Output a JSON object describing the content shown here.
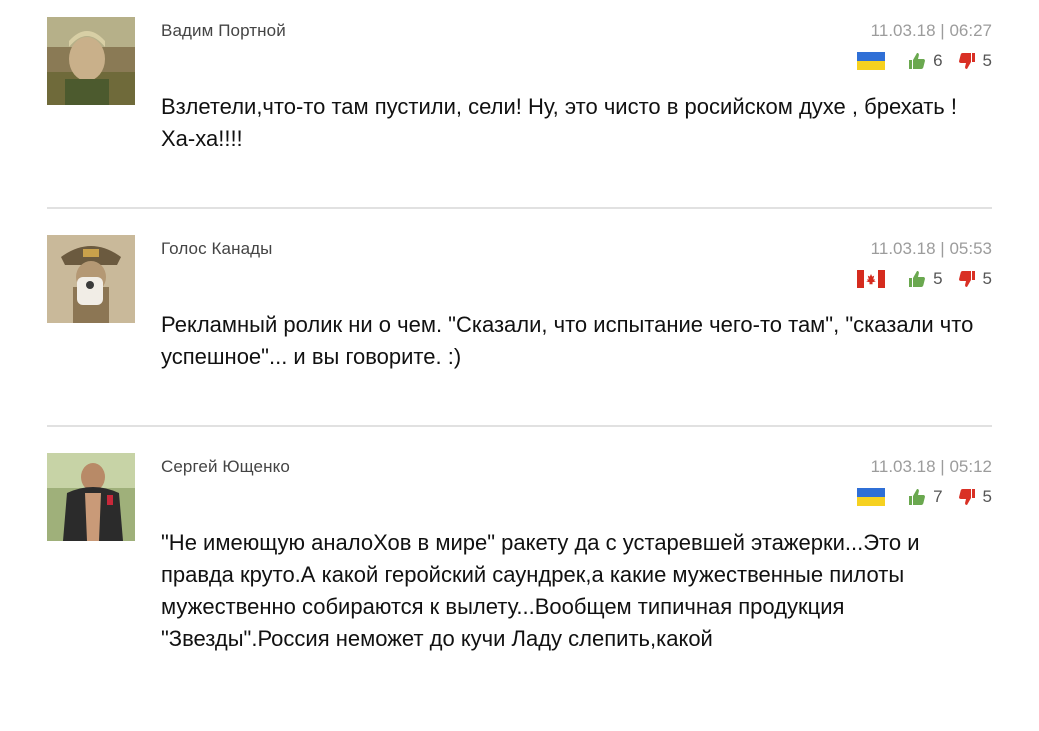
{
  "comments": [
    {
      "author": "Вадим Портной",
      "date": "11.03.18 | 06:27",
      "flag": "ukraine-flag-icon",
      "likes": "6",
      "dislikes": "5",
      "text": "Взлетели,что-то там пустили, сели! Ну, это чисто в росийском духе , брехать ! Ха-ха!!!!"
    },
    {
      "author": "Голос Канады",
      "date": "11.03.18 | 05:53",
      "flag": "canada-flag-icon",
      "likes": "5",
      "dislikes": "5",
      "text": "Рекламный ролик ни о чем. \"Сказали, что испытание чего-то там\", \"сказали что успешное\"... и вы говорите. :)"
    },
    {
      "author": "Сергей Ющенко",
      "date": "11.03.18 | 05:12",
      "flag": "ukraine-flag-icon",
      "likes": "7",
      "dislikes": "5",
      "text": "\"Не имеющую аналоХов в мире\" ракету да с устаревшей этажерки...Это и правда круто.А какой геройский саундрек,а какие мужественные пилоты мужественно собираются к вылету...Вообщем типичная продукция \"Звезды\".Россия неможет до кучи Ладу слепить,какой"
    }
  ],
  "colors": {
    "like": "#6aa84f",
    "dislike": "#d93025",
    "date": "#9c9c9c",
    "separator": "#e1e1e1"
  }
}
